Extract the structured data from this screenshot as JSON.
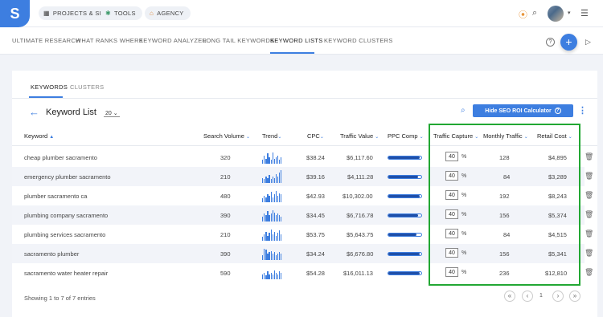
{
  "logo": "S",
  "top_nav": {
    "items": [
      {
        "label": "PROJECTS & SITES"
      },
      {
        "label": "TOOLS"
      },
      {
        "label": "AGENCY"
      }
    ]
  },
  "sub_nav": {
    "items": [
      {
        "label": "ULTIMATE RESEARCH"
      },
      {
        "label": "WHAT RANKS WHERE"
      },
      {
        "label": "KEYWORD ANALYZER"
      },
      {
        "label": "LONG TAIL KEYWORDS"
      },
      {
        "label": "KEYWORD LISTS"
      },
      {
        "label": "KEYWORD CLUSTERS"
      }
    ],
    "active": "KEYWORD LISTS"
  },
  "inner_tabs": [
    {
      "label": "KEYWORDS"
    },
    {
      "label": "CLUSTERS"
    }
  ],
  "page": {
    "title": "Keyword List",
    "count_select": "20",
    "roi_button": "Hide SEO ROI Calculator"
  },
  "table": {
    "headers": {
      "keyword": "Keyword",
      "search_volume": "Search Volume",
      "trend": "Trend",
      "cpc": "CPC",
      "traffic_value": "Traffic Value",
      "ppc_comp": "PPC Comp",
      "traffic_capture": "Traffic Capture",
      "monthly_traffic": "Monthly Traffic",
      "retail_cost": "Retail Cost"
    },
    "rows": [
      {
        "keyword": "cheap plumber sacramento",
        "search_volume": "320",
        "cpc": "$38.24",
        "traffic_value": "$6,117.60",
        "ppc_comp": 0.95,
        "traffic_capture": "40",
        "pct": "%",
        "monthly_traffic": "128",
        "retail_cost": "$4,895",
        "trend": [
          0.3,
          0.6,
          0.4,
          0.8,
          0.5,
          0.3,
          0.9,
          0.4,
          0.5,
          0.6,
          0.3,
          0.5
        ]
      },
      {
        "keyword": "emergency plumber sacramento",
        "search_volume": "210",
        "cpc": "$39.16",
        "traffic_value": "$4,111.28",
        "ppc_comp": 0.9,
        "traffic_capture": "40",
        "pct": "%",
        "monthly_traffic": "84",
        "retail_cost": "$3,289",
        "trend": [
          0.4,
          0.3,
          0.5,
          0.4,
          0.6,
          0.3,
          0.5,
          0.4,
          0.7,
          0.5,
          0.8,
          1.0
        ]
      },
      {
        "keyword": "plumber sacramento ca",
        "search_volume": "480",
        "cpc": "$42.93",
        "traffic_value": "$10,302.00",
        "ppc_comp": 0.95,
        "traffic_capture": "40",
        "pct": "%",
        "monthly_traffic": "192",
        "retail_cost": "$8,243",
        "trend": [
          0.3,
          0.5,
          0.4,
          0.6,
          0.5,
          0.8,
          0.4,
          0.6,
          0.9,
          0.5,
          0.7,
          0.6
        ]
      },
      {
        "keyword": "plumbing company sacramento",
        "search_volume": "390",
        "cpc": "$34.45",
        "traffic_value": "$6,716.78",
        "ppc_comp": 0.9,
        "traffic_capture": "40",
        "pct": "%",
        "monthly_traffic": "156",
        "retail_cost": "$5,374",
        "trend": [
          0.4,
          0.6,
          0.5,
          0.8,
          0.5,
          0.6,
          0.9,
          0.7,
          0.5,
          0.6,
          0.5,
          0.4
        ]
      },
      {
        "keyword": "plumbing services sacramento",
        "search_volume": "210",
        "cpc": "$53.75",
        "traffic_value": "$5,643.75",
        "ppc_comp": 0.85,
        "traffic_capture": "40",
        "pct": "%",
        "monthly_traffic": "84",
        "retail_cost": "$4,515",
        "trend": [
          0.3,
          0.5,
          0.7,
          0.4,
          0.6,
          0.9,
          0.5,
          0.7,
          0.4,
          0.6,
          0.8,
          0.5
        ]
      },
      {
        "keyword": "sacramento plumber",
        "search_volume": "390",
        "cpc": "$34.24",
        "traffic_value": "$6,676.80",
        "ppc_comp": 0.95,
        "traffic_capture": "40",
        "pct": "%",
        "monthly_traffic": "156",
        "retail_cost": "$5,341",
        "trend": [
          0.4,
          0.9,
          0.8,
          0.5,
          0.6,
          0.7,
          0.5,
          0.6,
          0.4,
          0.5,
          0.6,
          0.5
        ]
      },
      {
        "keyword": "sacramento water heater repair",
        "search_volume": "590",
        "cpc": "$54.28",
        "traffic_value": "$16,011.13",
        "ppc_comp": 0.95,
        "traffic_capture": "40",
        "pct": "%",
        "monthly_traffic": "236",
        "retail_cost": "$12,810",
        "trend": [
          0.4,
          0.5,
          0.3,
          0.6,
          0.4,
          0.5,
          0.4,
          0.7,
          0.5,
          0.4,
          0.6,
          0.5
        ]
      }
    ]
  },
  "footer": {
    "entries_text": "Showing 1 to 7 of 7 entries",
    "current_page": "1"
  },
  "colors": {
    "accent": "#3d7ee0",
    "highlight_box": "#22a733"
  }
}
